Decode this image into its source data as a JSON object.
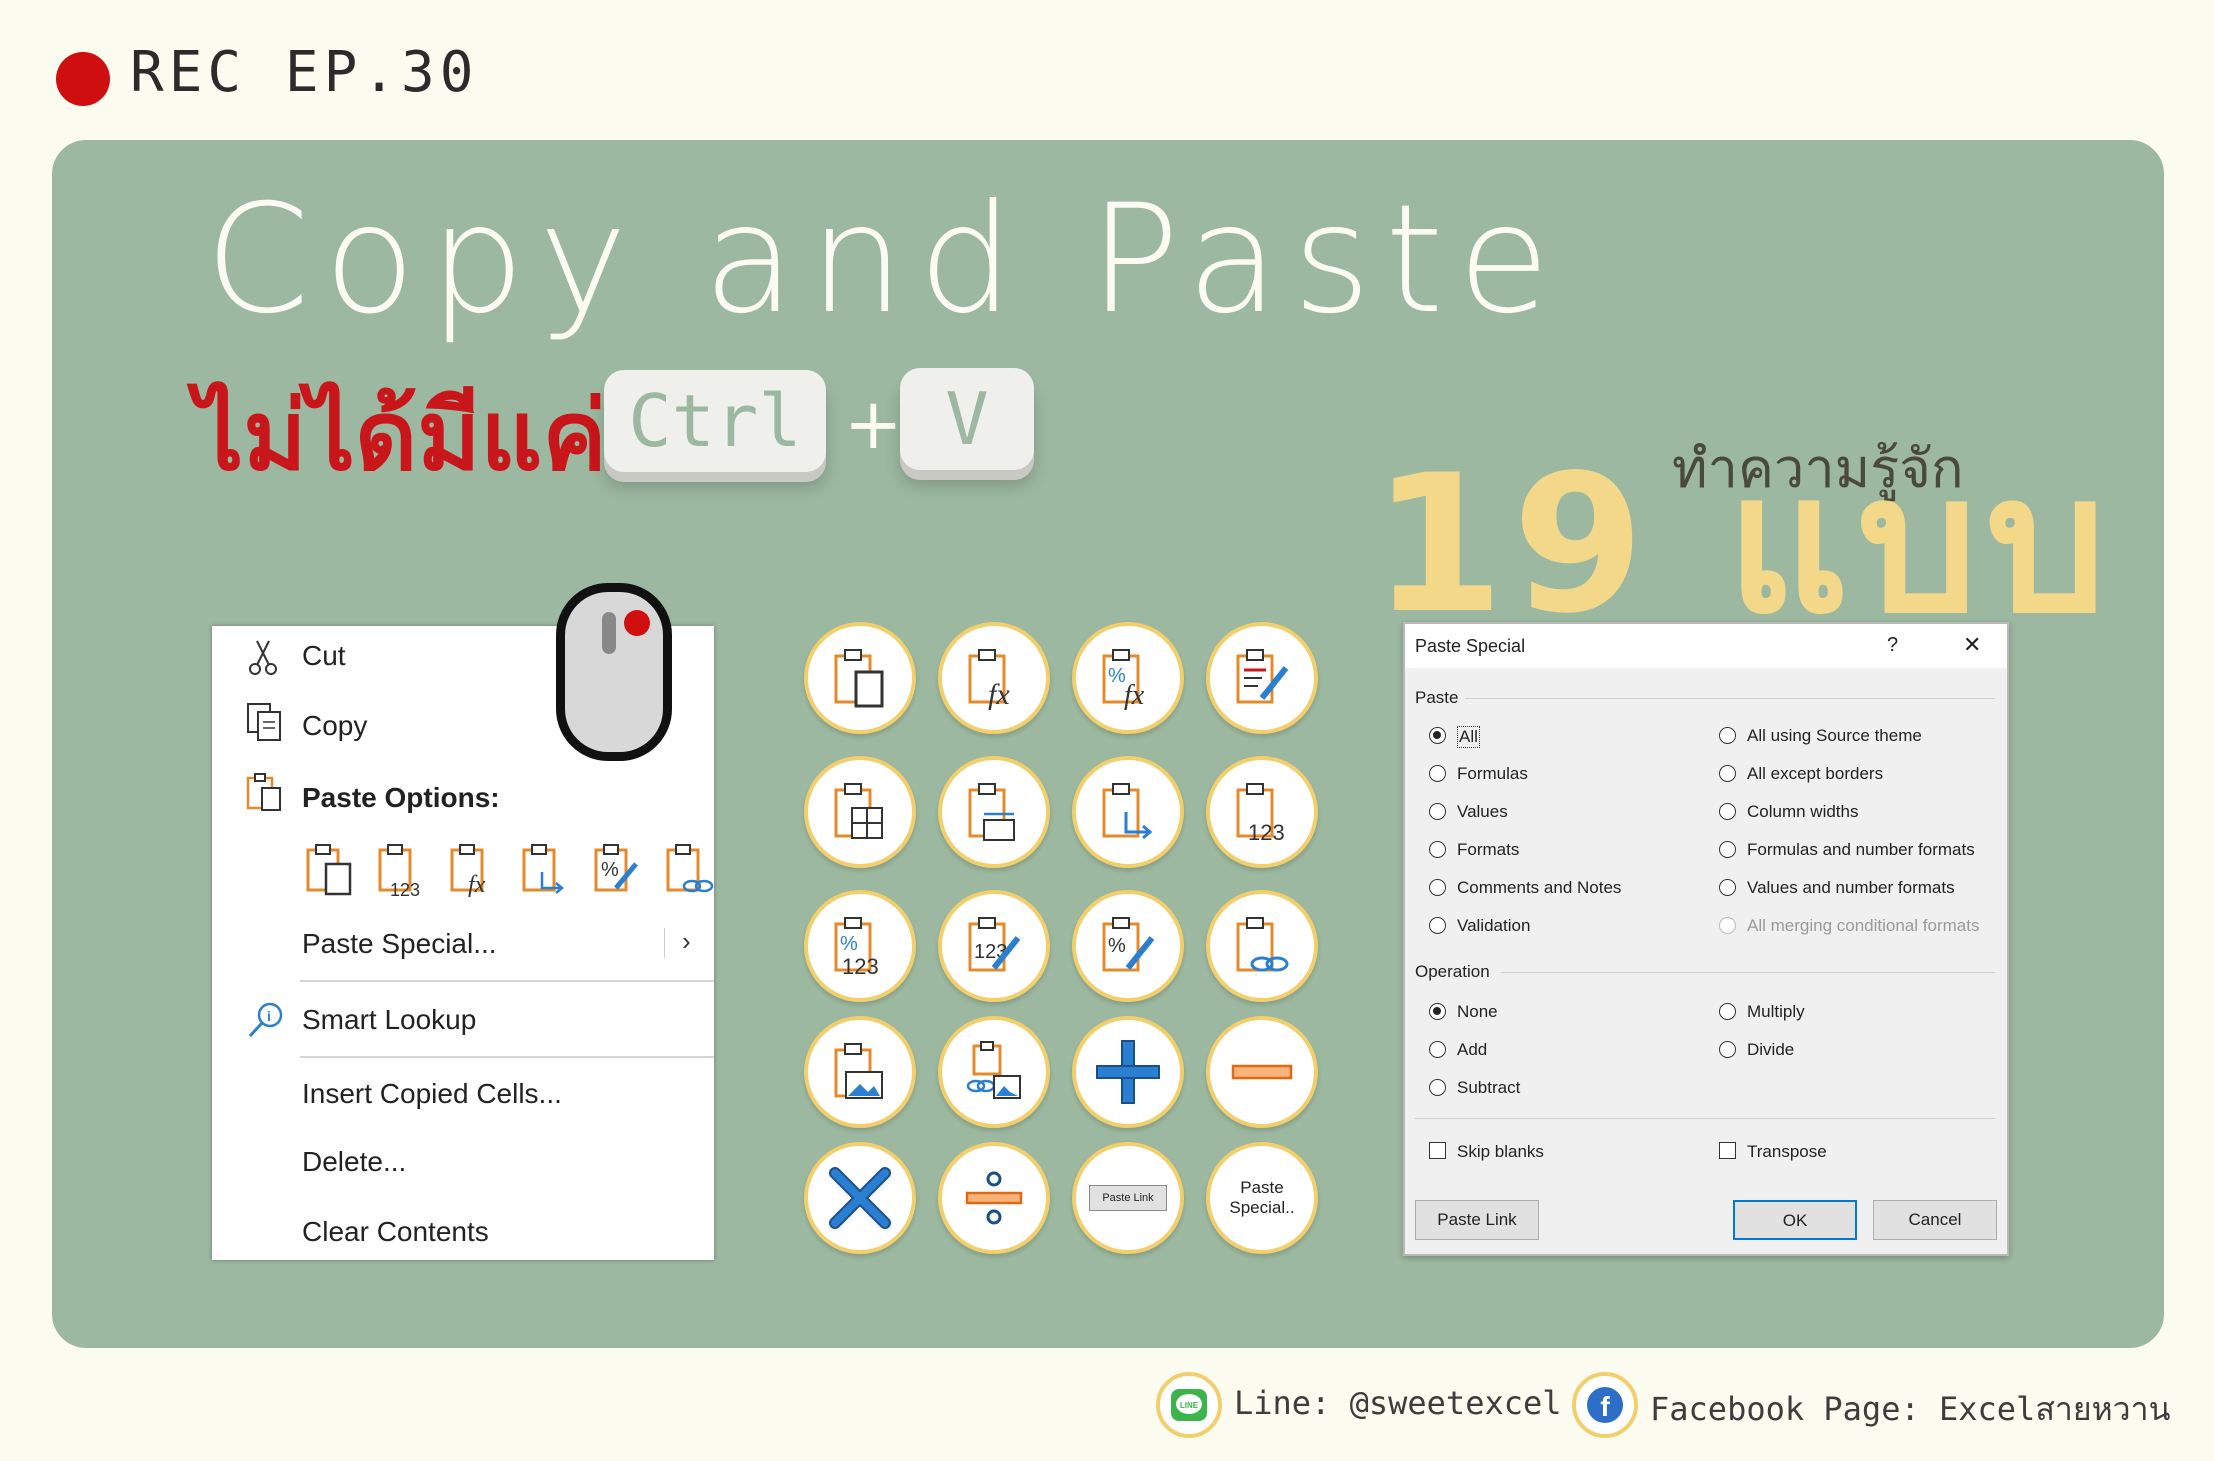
{
  "header": {
    "rec_label": "REC EP.30"
  },
  "hero": {
    "title": "Copy and Paste",
    "thai_subtitle": "ไม่ได้มีแค่",
    "key_ctrl": "Ctrl",
    "plus": "+",
    "key_v": "V",
    "know_label": "ทำความรู้จัก",
    "count_label": "19 แบบ"
  },
  "context_menu": {
    "cut": "Cut",
    "copy": "Copy",
    "paste_options": "Paste Options:",
    "paste_special": "Paste Special...",
    "smart_lookup": "Smart Lookup",
    "insert_copied_cells": "Insert Copied Cells...",
    "delete": "Delete...",
    "clear_contents": "Clear Contents",
    "paste_option_icons": [
      "paste-icon",
      "paste-values-icon",
      "paste-formulas-icon",
      "paste-transpose-icon",
      "paste-formatting-icon",
      "paste-link-icon"
    ]
  },
  "icon_grid": {
    "icons": [
      "paste-icon",
      "paste-formulas-icon",
      "paste-formulas-number-formatting-icon",
      "paste-keep-source-formatting-icon",
      "paste-no-borders-icon",
      "paste-keep-column-widths-icon",
      "paste-transpose-icon",
      "paste-values-icon",
      "paste-values-number-formatting-icon",
      "paste-values-source-formatting-icon",
      "paste-formatting-icon",
      "paste-link-icon",
      "paste-picture-icon",
      "paste-linked-picture-icon",
      "add-operation-icon",
      "subtract-operation-icon",
      "multiply-operation-icon",
      "divide-operation-icon",
      "paste-link-button-icon",
      "paste-special-icon"
    ],
    "paste_link_label": "Paste Link",
    "paste_special_label": "Paste Special.."
  },
  "dialog": {
    "title": "Paste Special",
    "help": "?",
    "close": "✕",
    "paste_group": "Paste",
    "paste_left": [
      "All",
      "Formulas",
      "Values",
      "Formats",
      "Comments and Notes",
      "Validation"
    ],
    "paste_right": [
      "All using Source theme",
      "All except borders",
      "Column widths",
      "Formulas and number formats",
      "Values and number formats",
      "All merging conditional formats"
    ],
    "operation_group": "Operation",
    "op_left": [
      "None",
      "Add",
      "Subtract"
    ],
    "op_right": [
      "Multiply",
      "Divide"
    ],
    "skip_blanks": "Skip blanks",
    "transpose": "Transpose",
    "paste_link_btn": "Paste Link",
    "ok_btn": "OK",
    "cancel_btn": "Cancel"
  },
  "footer": {
    "line_label": "Line: @sweetexcel",
    "facebook_label": "Facebook Page: Excelสายหวาน"
  },
  "colors": {
    "board": "#9cb8a0",
    "background": "#fbfbef",
    "accent_yellow": "#f3d88a",
    "rec_red": "#cf0f0f",
    "thai_red": "#c9161a",
    "icon_blue": "#2b7fd1",
    "icon_orange": "#e38b2c"
  }
}
